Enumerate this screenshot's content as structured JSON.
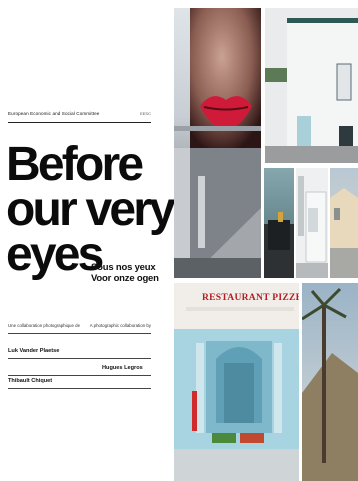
{
  "header": {
    "publisher": "European Economic and Social Committee",
    "code": "EESC"
  },
  "title_lines": [
    "Before",
    "our very",
    "eyes"
  ],
  "subtitle": {
    "french": "Sous nos yeux",
    "dutch": "Voor onze ogen"
  },
  "credits": {
    "left_caption": "Une collaboration photographique de",
    "right_caption": "A photographic collaboration by",
    "authors": [
      "Luk Vander Plaetse",
      "Hugues Legros",
      "Thibault Chiquet"
    ]
  },
  "photos": {
    "restaurant_sign": "RESTAURANT PIZZERIA"
  },
  "colors": {
    "title": "#0b0b0b",
    "lips": "#d01a3a",
    "sign_red": "#b31d24",
    "facade_blue": "#9ecbd9"
  }
}
